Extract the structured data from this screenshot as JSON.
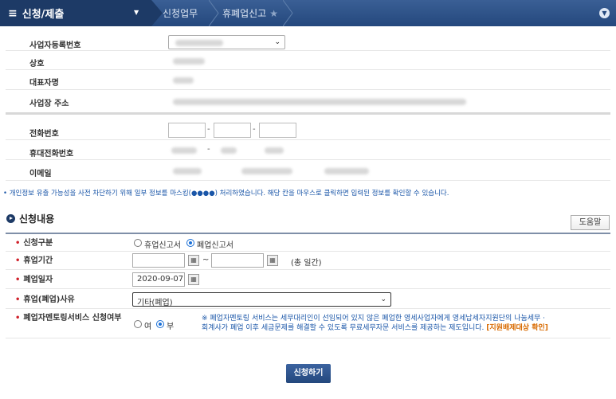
{
  "header": {
    "menu_title": "신청/제출",
    "crumbs": [
      "신청업무",
      "휴폐업신고"
    ]
  },
  "info": {
    "biz_no_label": "사업자등록번호",
    "company_label": "상호",
    "ceo_label": "대표자명",
    "address_label": "사업장 주소",
    "phone_label": "전화번호",
    "mobile_label": "휴대전화번호",
    "email_label": "이메일",
    "dash": "-"
  },
  "notice": "• 개인정보 유출 가능성을 사전 차단하기 위해 일부 정보를 마스킹(●●●●) 처리하였습니다. 해당 칸을 마우스로 클릭하면 입력된 정보를 확인할 수 있습니다.",
  "section": {
    "title": "신청내용",
    "help_label": "도움말"
  },
  "form": {
    "type_label": "신청구분",
    "type_options": [
      "휴업신고서",
      "폐업신고서"
    ],
    "period_label": "휴업기간",
    "period_sep": "~",
    "period_suffix": "(총   일간)",
    "close_date_label": "폐업일자",
    "close_date_value": "2020-09-07",
    "reason_label": "휴업(폐업)사유",
    "reason_value": "기타(폐업)",
    "mentor_label": "폐업자멘토링서비스 신청여부",
    "mentor_options": [
      "여",
      "부"
    ],
    "mentor_desc_1": "※ 폐업자멘토링 서비스는 세무대리인이 선임되어 있지 않은 폐업한 영세사업자에게 영세납세자지원단의 나눔세무 ·",
    "mentor_desc_2": "회계사가 폐업 이후 세금문제를 해결할 수 있도록 무료세무자문 서비스를 제공하는 제도입니다.",
    "mentor_link": "[지원배제대상 확인]"
  },
  "submit_label": "신청하기"
}
